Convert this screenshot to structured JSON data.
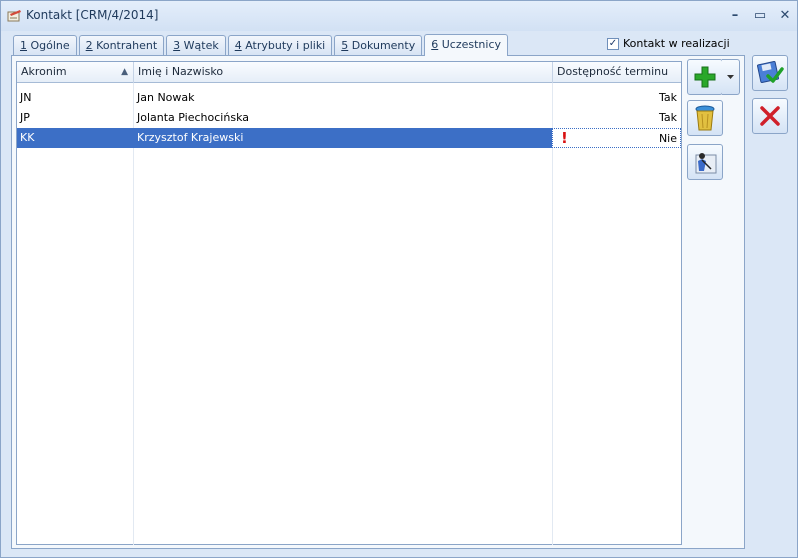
{
  "window": {
    "title": "Kontakt [CRM/4/2014]",
    "minimize_label": "–",
    "maximize_label": "▭",
    "close_label": "✕"
  },
  "tabs": [
    {
      "key": "1",
      "label": " Ogólne"
    },
    {
      "key": "2",
      "label": " Kontrahent"
    },
    {
      "key": "3",
      "label": " Wątek"
    },
    {
      "key": "4",
      "label": " Atrybuty i pliki"
    },
    {
      "key": "5",
      "label": " Dokumenty"
    },
    {
      "key": "6",
      "label": " Uczestnicy"
    }
  ],
  "active_tab": 5,
  "realization_checkbox": {
    "label": "Kontakt w realizacji",
    "checked": true,
    "mark": "✓"
  },
  "grid": {
    "columns": [
      "Akronim",
      "Imię i Nazwisko",
      "Dostępność terminu"
    ],
    "sort_indicator": "▲",
    "rows": [
      {
        "akronim": "JN",
        "name": "Jan Nowak",
        "availability": "Tak",
        "warning": ""
      },
      {
        "akronim": "JP",
        "name": "Jolanta Piechocińska",
        "availability": "Tak",
        "warning": ""
      },
      {
        "akronim": "KK",
        "name": "Krzysztof Krajewski",
        "availability": "Nie",
        "warning": "!"
      }
    ],
    "selected_row": 2
  },
  "buttons": {
    "add_icon": "plus-icon",
    "delete_icon": "trash-icon",
    "person_icon": "person-icon",
    "save_icon": "save-icon",
    "cancel_icon": "cancel-icon"
  },
  "colors": {
    "selection": "#3c6fc6",
    "window_bg": "#dbe7f6",
    "warning": "#d81010",
    "add_green": "#2aa82a",
    "cancel_red": "#d0202a"
  }
}
